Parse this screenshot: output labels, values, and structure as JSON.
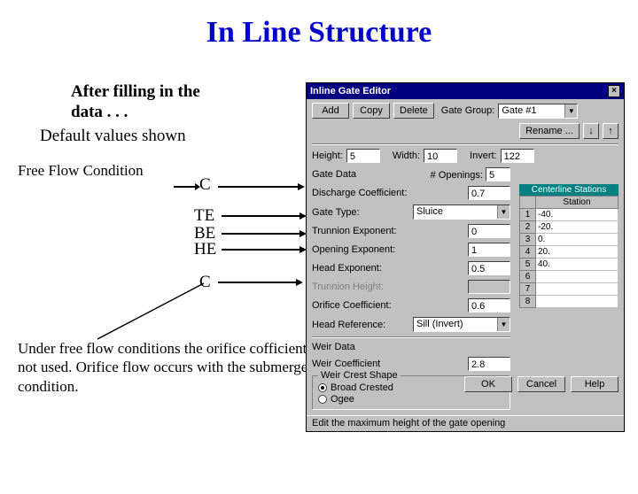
{
  "title": "In Line Structure",
  "intro_line1": "After filling in the",
  "intro_line2": "data . . .",
  "intro_line3": "Default values shown",
  "free_flow_label": "Free Flow Condition",
  "pointer_labels": {
    "c1": "C",
    "te": "TE",
    "be": "BE",
    "he": "HE",
    "c2": "C"
  },
  "footnote": "Under free flow conditions the orifice cofficient is not used.  Orifice flow occurs with the submerged condition.",
  "dialog": {
    "title": "Inline Gate Editor",
    "buttons": {
      "add": "Add",
      "copy": "Copy",
      "delete": "Delete",
      "rename": "Rename ...",
      "ok": "OK",
      "cancel": "Cancel",
      "help": "Help"
    },
    "gate_group_lbl": "Gate Group:",
    "gate_group_val": "Gate #1",
    "arrow_down": "↓",
    "arrow_up": "↑",
    "height_lbl": "Height:",
    "height_val": "5",
    "width_lbl": "Width:",
    "width_val": "10",
    "invert_lbl": "Invert:",
    "invert_val": "122",
    "gate_data_lbl": "Gate Data",
    "openings_lbl": "# Openings:",
    "openings_val": "5",
    "disch_lbl": "Discharge Coefficient:",
    "disch_val": "0.7",
    "gate_type_lbl": "Gate Type:",
    "gate_type_val": "Sluice",
    "trun_exp_lbl": "Trunnion Exponent:",
    "trun_exp_val": "0",
    "open_exp_lbl": "Opening Exponent:",
    "open_exp_val": "1",
    "head_exp_lbl": "Head Exponent:",
    "head_exp_val": "0.5",
    "trun_h_lbl": "Trunnion Height:",
    "orifice_lbl": "Orifice Coefficient:",
    "orifice_val": "0.6",
    "head_ref_lbl": "Head Reference:",
    "head_ref_val": "Sill (Invert)",
    "weir_data_lbl": "Weir Data",
    "weir_coef_lbl": "Weir Coefficient",
    "weir_coef_val": "2.8",
    "weir_shape_lbl": "Weir Crest Shape",
    "radio_broad": "Broad Crested",
    "radio_ogee": "Ogee",
    "station_header": "Centerline Stations",
    "station_col": "Station",
    "stations": [
      {
        "n": "1",
        "v": "-40."
      },
      {
        "n": "2",
        "v": "-20."
      },
      {
        "n": "3",
        "v": "0."
      },
      {
        "n": "4",
        "v": "20."
      },
      {
        "n": "5",
        "v": "40."
      },
      {
        "n": "6",
        "v": ""
      },
      {
        "n": "7",
        "v": ""
      },
      {
        "n": "8",
        "v": ""
      }
    ],
    "status": "Edit the maximum height of the gate opening"
  }
}
